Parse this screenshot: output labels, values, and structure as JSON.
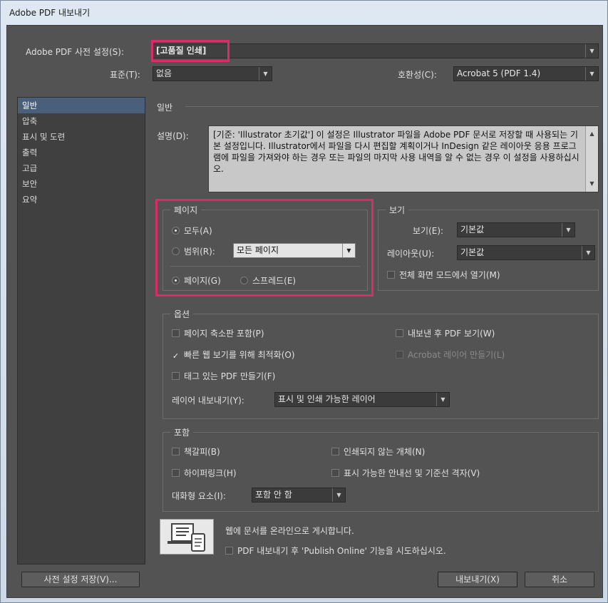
{
  "window": {
    "title": "Adobe PDF 내보내기"
  },
  "preset": {
    "label": "Adobe PDF 사전 설정(S):",
    "value": "[고품질 인쇄]"
  },
  "standard": {
    "label": "표준(T):",
    "value": "없음"
  },
  "compat": {
    "label": "호환성(C):",
    "value": "Acrobat 5 (PDF 1.4)"
  },
  "sidebar": {
    "items": [
      {
        "label": "일반"
      },
      {
        "label": "압축"
      },
      {
        "label": "표시 및 도련"
      },
      {
        "label": "출력"
      },
      {
        "label": "고급"
      },
      {
        "label": "보안"
      },
      {
        "label": "요약"
      }
    ]
  },
  "section_title": "일반",
  "description": {
    "label": "설명(D):",
    "text": "[기준: 'Illustrator 초기값'] 이 설정은 Illustrator 파일을 Adobe PDF 문서로 저장할 때 사용되는 기본 설정입니다. Illustrator에서 파일을 다시 편집할 계획이거나 InDesign 같은 레이아웃 응용 프로그램에 파일을 가져와야 하는 경우 또는 파일의 마지막 사용 내역을 알 수 없는 경우 이 설정을 사용하십시오."
  },
  "pages": {
    "title": "페이지",
    "all": "모두(A)",
    "range_label": "범위(R):",
    "range_value": "모든 페이지",
    "pages_opt": "페이지(G)",
    "spread_opt": "스프레드(E)"
  },
  "view": {
    "title": "보기",
    "view_label": "보기(E):",
    "view_value": "기본값",
    "layout_label": "레이아웃(U):",
    "layout_value": "기본값",
    "fullscreen": "전체 화면 모드에서 열기(M)"
  },
  "options": {
    "title": "옵션",
    "thumbnails": "페이지 축소판 포함(P)",
    "view_after": "내보낸 후 PDF 보기(W)",
    "fast_web": "빠른 웹 보기를 위해 최적화(O)",
    "acrobat_layers": "Acrobat 레이어 만들기(L)",
    "tagged": "태그 있는 PDF 만들기(F)",
    "export_layers_label": "레이어 내보내기(Y):",
    "export_layers_value": "표시 및 인쇄 가능한 레이어"
  },
  "include": {
    "title": "포함",
    "bookmarks": "책갈피(B)",
    "non_printing": "인쇄되지 않는 개체(N)",
    "hyperlinks": "하이퍼링크(H)",
    "guides": "표시 가능한 안내선 및 기준선 격자(V)",
    "interactive_label": "대화형 요소(I):",
    "interactive_value": "포함 안 함"
  },
  "publish": {
    "line1": "웹에 문서를 온라인으로 게시합니다.",
    "line2": "PDF 내보내기 후 'Publish Online' 기능을 시도하십시오."
  },
  "buttons": {
    "save_preset": "사전 설정 저장(V)...",
    "export": "내보내기(X)",
    "cancel": "취소"
  },
  "colors": {
    "highlight": "#d92d6a",
    "selected": "#4a607a",
    "panel": "#535353"
  },
  "icons": {
    "dropdown": "chevron-down-icon",
    "publish": "publish-devices-icon"
  }
}
